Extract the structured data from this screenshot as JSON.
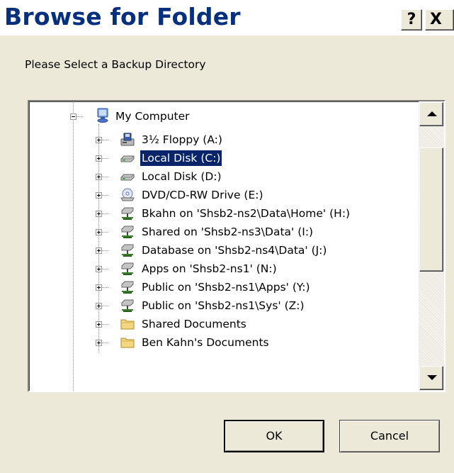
{
  "dialog": {
    "title": "Browse for Folder",
    "help_label": "?",
    "close_label": "X",
    "prompt": "Please Select a Backup Directory"
  },
  "tree": {
    "root": {
      "label": "My Computer",
      "icon": "computer-icon",
      "expanded": true
    },
    "items": [
      {
        "label": "3½ Floppy (A:)",
        "icon": "floppy-drive-icon"
      },
      {
        "label": "Local Disk (C:)",
        "icon": "hard-disk-icon",
        "selected": true
      },
      {
        "label": "Local Disk (D:)",
        "icon": "hard-disk-icon"
      },
      {
        "label": "DVD/CD-RW Drive (E:)",
        "icon": "cd-drive-icon"
      },
      {
        "label": "Bkahn on 'Shsb2-ns2\\Data\\Home' (H:)",
        "icon": "network-drive-icon"
      },
      {
        "label": "Shared on 'Shsb2-ns3\\Data' (I:)",
        "icon": "network-drive-icon"
      },
      {
        "label": "Database on 'Shsb2-ns4\\Data' (J:)",
        "icon": "network-drive-icon"
      },
      {
        "label": "Apps on 'Shsb2-ns1' (N:)",
        "icon": "network-drive-icon"
      },
      {
        "label": "Public on 'Shsb2-ns1\\Apps' (Y:)",
        "icon": "network-drive-icon"
      },
      {
        "label": "Public on 'Shsb2-ns1\\Sys' (Z:)",
        "icon": "network-drive-icon"
      },
      {
        "label": "Shared Documents",
        "icon": "folder-icon"
      },
      {
        "label": "Ben Kahn's Documents",
        "icon": "folder-icon"
      }
    ]
  },
  "buttons": {
    "ok_label": "OK",
    "cancel_label": "Cancel"
  },
  "colors": {
    "title_text": "#06307e",
    "selection": "#0a246a",
    "dialog_bg": "#ece9d8"
  }
}
